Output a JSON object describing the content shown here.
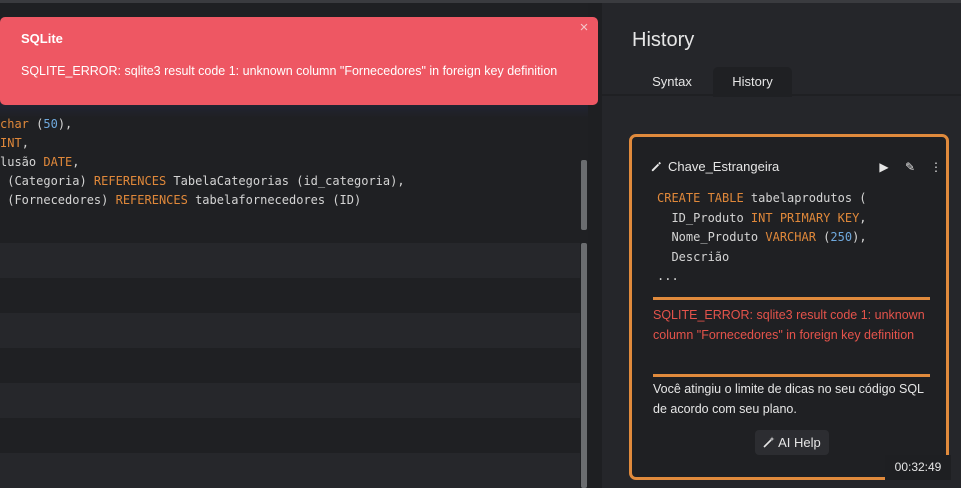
{
  "editor": {
    "code_lines": [
      [
        {
          "t": "char",
          "c": "kw"
        },
        {
          "t": " ("
        },
        {
          "t": "50",
          "c": "num"
        },
        {
          "t": "),"
        }
      ],
      [
        {
          "t": "INT",
          "c": "kw"
        },
        {
          "t": ","
        }
      ],
      [
        {
          "t": "lusão "
        },
        {
          "t": "DATE",
          "c": "kw"
        },
        {
          "t": ","
        }
      ],
      [
        {
          "t": " (Categoria) "
        },
        {
          "t": "REFERENCES",
          "c": "kw"
        },
        {
          "t": " TabelaCategorias (id_categoria),"
        }
      ],
      [
        {
          "t": " (Fornecedores) "
        },
        {
          "t": "REFERENCES",
          "c": "kw"
        },
        {
          "t": " tabelafornecedores (ID)"
        }
      ]
    ]
  },
  "toast": {
    "title": "SQLite",
    "message": "SQLITE_ERROR: sqlite3 result code 1: unknown column \"Fornecedores\" in foreign key definition",
    "close": "×",
    "bg_color": "#ee5763"
  },
  "panel": {
    "title": "History",
    "tabs": [
      {
        "label": "Syntax",
        "active": false
      },
      {
        "label": "History",
        "active": true
      }
    ]
  },
  "history_card": {
    "name": "Chave_Estrangeira",
    "actions": {
      "run": "▶",
      "edit": "✎",
      "more": "⋮"
    },
    "snippet": [
      [
        {
          "t": "CREATE TABLE",
          "c": "kw"
        },
        {
          "t": " tabelaprodutos ("
        }
      ],
      [
        {
          "t": "  ID_Produto "
        },
        {
          "t": "INT PRIMARY KEY",
          "c": "kw"
        },
        {
          "t": ","
        }
      ],
      [
        {
          "t": "  Nome_Produto "
        },
        {
          "t": "VARCHAR",
          "c": "kw"
        },
        {
          "t": " ("
        },
        {
          "t": "250",
          "c": "num"
        },
        {
          "t": "),"
        }
      ],
      [
        {
          "t": "  Descrião"
        }
      ],
      [
        {
          "t": "..."
        }
      ]
    ],
    "error": "SQLITE_ERROR: sqlite3 result code 1: unknown column \"Fornecedores\" in foreign key definition",
    "limit_message": "Você atingiu o limite de dicas no seu código SQL de acordo com seu plano.",
    "ai_help_label": "AI Help",
    "accent_color": "#e08a3c",
    "error_color": "#e5534b"
  },
  "timer": "00:32:49"
}
